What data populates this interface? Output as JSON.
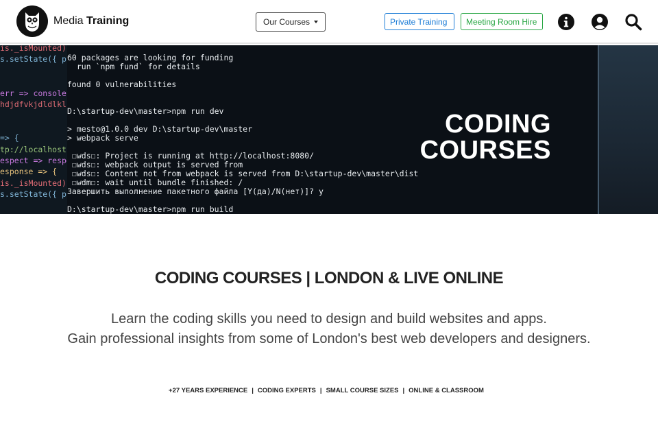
{
  "header": {
    "brand_light": "Media",
    "brand_bold": "Training",
    "courses_button": "Our Courses",
    "private_training": "Private Training",
    "meeting_room_hire": "Meeting Room Hire",
    "icons": [
      "owl-logo-icon",
      "info-icon",
      "user-icon",
      "search-icon"
    ]
  },
  "hero": {
    "title_line1": "CODING",
    "title_line2": "COURSES",
    "terminal_lines": [
      "60 packages are looking for funding",
      "  run `npm fund` for details",
      "",
      "found 0 vulnerabilities",
      "",
      "",
      "D:\\startup-dev\\master>npm run dev",
      "",
      "> mesto@1.0.0 dev D:\\startup-dev\\master",
      "> webpack serve",
      "",
      " ☐wds☐: Project is running at http://localhost:8080/",
      " ☐wds☐: webpack output is served from",
      " ☐wds☐: Content not from webpack is served from D:\\startup-dev\\master\\dist",
      " ☐wdm☐: wait until bundle finished: /",
      "Завершить выполнение пакетного файла [Y(да)/N(нет)]? y",
      "",
      "D:\\startup-dev\\master>npm run build"
    ],
    "editor_lines": [
      "is._isMounted)",
      "s.setState({ pr",
      "",
      "",
      "err => console.",
      "hdjdfvkjdldlkl",
      "",
      "",
      "=> {",
      "tp://localhost:",
      "espect => respo",
      "esponse => {",
      "is._isMounted)",
      "s.setState({ pr"
    ]
  },
  "main": {
    "headline": "CODING COURSES | LONDON & LIVE ONLINE",
    "intro_line1": "Learn the coding skills you need to design and build websites and apps.",
    "intro_line2": "Gain professional insights from some of London's best web developers and designers.",
    "features": [
      "+27 YEARS EXPERIENCE",
      "CODING EXPERTS",
      "SMALL COURSE SIZES",
      "ONLINE & CLASSROOM"
    ],
    "feature_separator": "|"
  },
  "colors": {
    "private_training": "#1a7bd6",
    "meeting_room_hire": "#2aa745",
    "hero_bg": "#0b1016"
  }
}
